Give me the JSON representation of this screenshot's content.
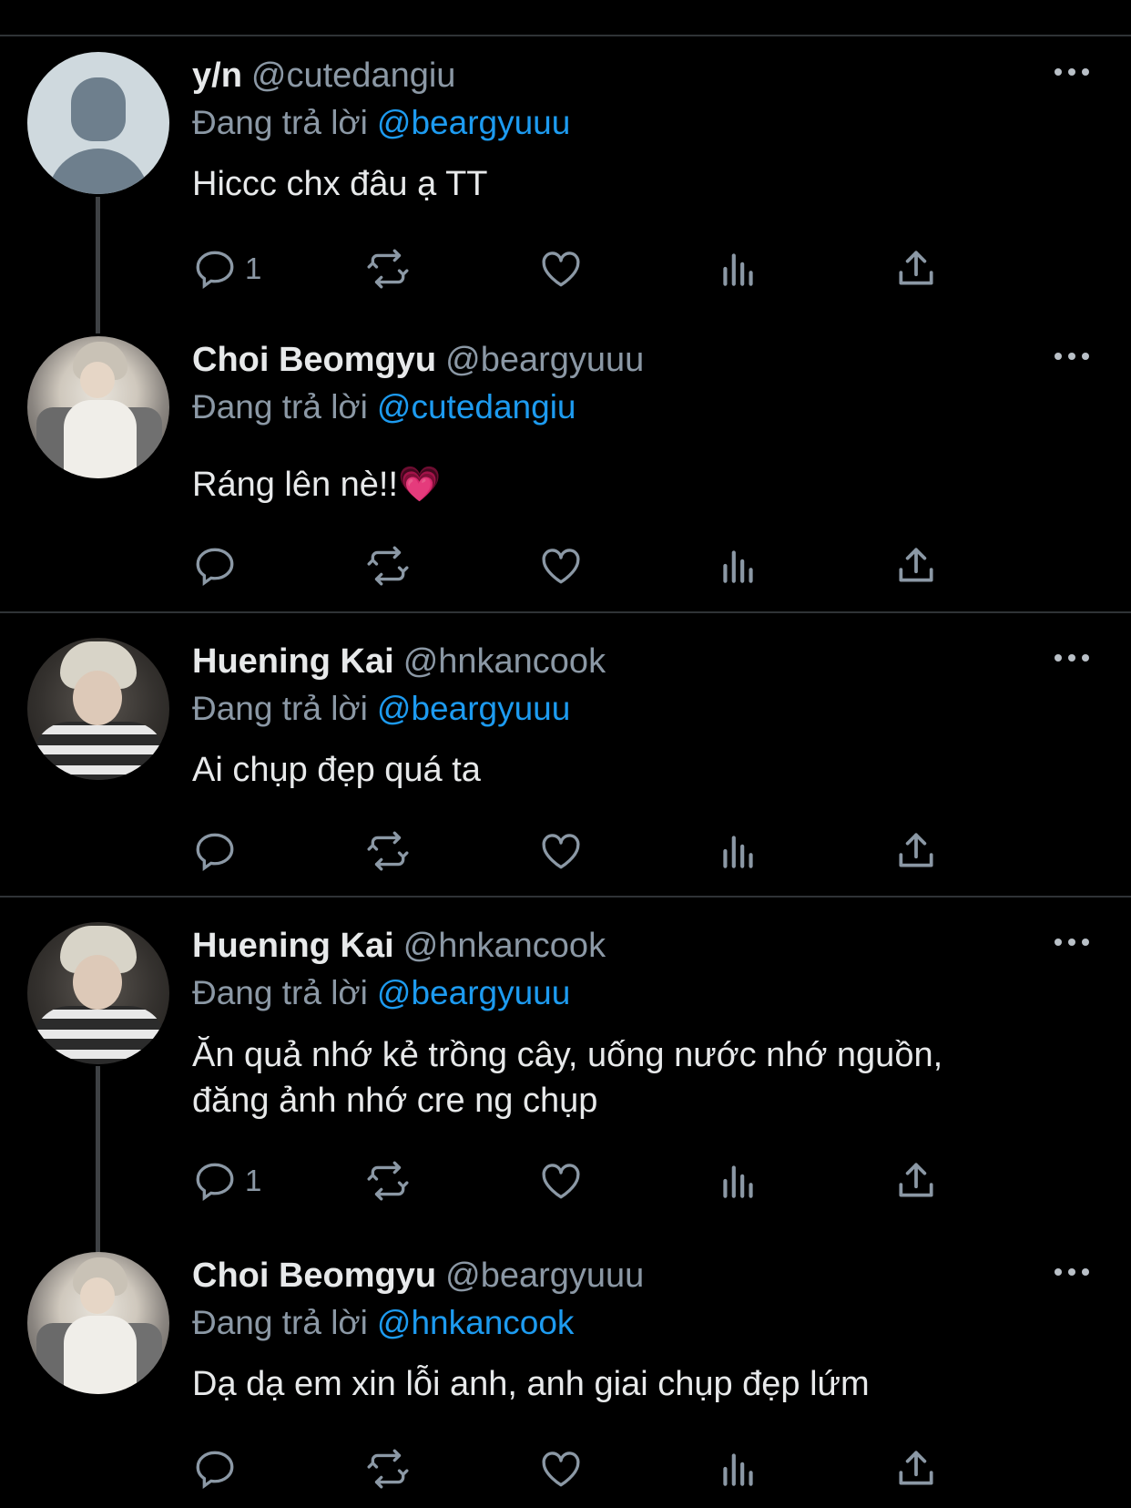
{
  "reply_prefix": "Đang trả lời",
  "tweets": [
    {
      "name": "y/n",
      "handle": "@cutedangiu",
      "reply_to": "@beargyuuu",
      "text": "Hiccc chx đâu ạ TT",
      "reply_count": "1"
    },
    {
      "name": "Choi Beomgyu",
      "handle": "@beargyuuu",
      "reply_to": "@cutedangiu",
      "text": "Ráng lên nè!!",
      "emoji": "💗",
      "reply_count": ""
    },
    {
      "name": "Huening Kai",
      "handle": "@hnkancook",
      "reply_to": "@beargyuuu",
      "text": "Ai chụp đẹp quá ta",
      "reply_count": ""
    },
    {
      "name": "Huening Kai",
      "handle": "@hnkancook",
      "reply_to": "@beargyuuu",
      "text": "Ăn quả nhớ kẻ trồng cây, uống nước nhớ nguồn,\nđăng ảnh nhớ cre ng chụp",
      "reply_count": "1"
    },
    {
      "name": "Choi Beomgyu",
      "handle": "@beargyuuu",
      "reply_to": "@hnkancook",
      "text": "Dạ dạ em xin lỗi anh, anh giai chụp đẹp lứm",
      "reply_count": ""
    }
  ],
  "icons": {
    "reply": "reply-icon",
    "retweet": "retweet-icon",
    "like": "heart-icon",
    "views": "views-icon",
    "share": "share-icon",
    "more": "more-icon"
  },
  "colors": {
    "background": "#000000",
    "link": "#1d9bf0",
    "secondary_text": "#8b98a5",
    "divider": "#2f3336"
  }
}
